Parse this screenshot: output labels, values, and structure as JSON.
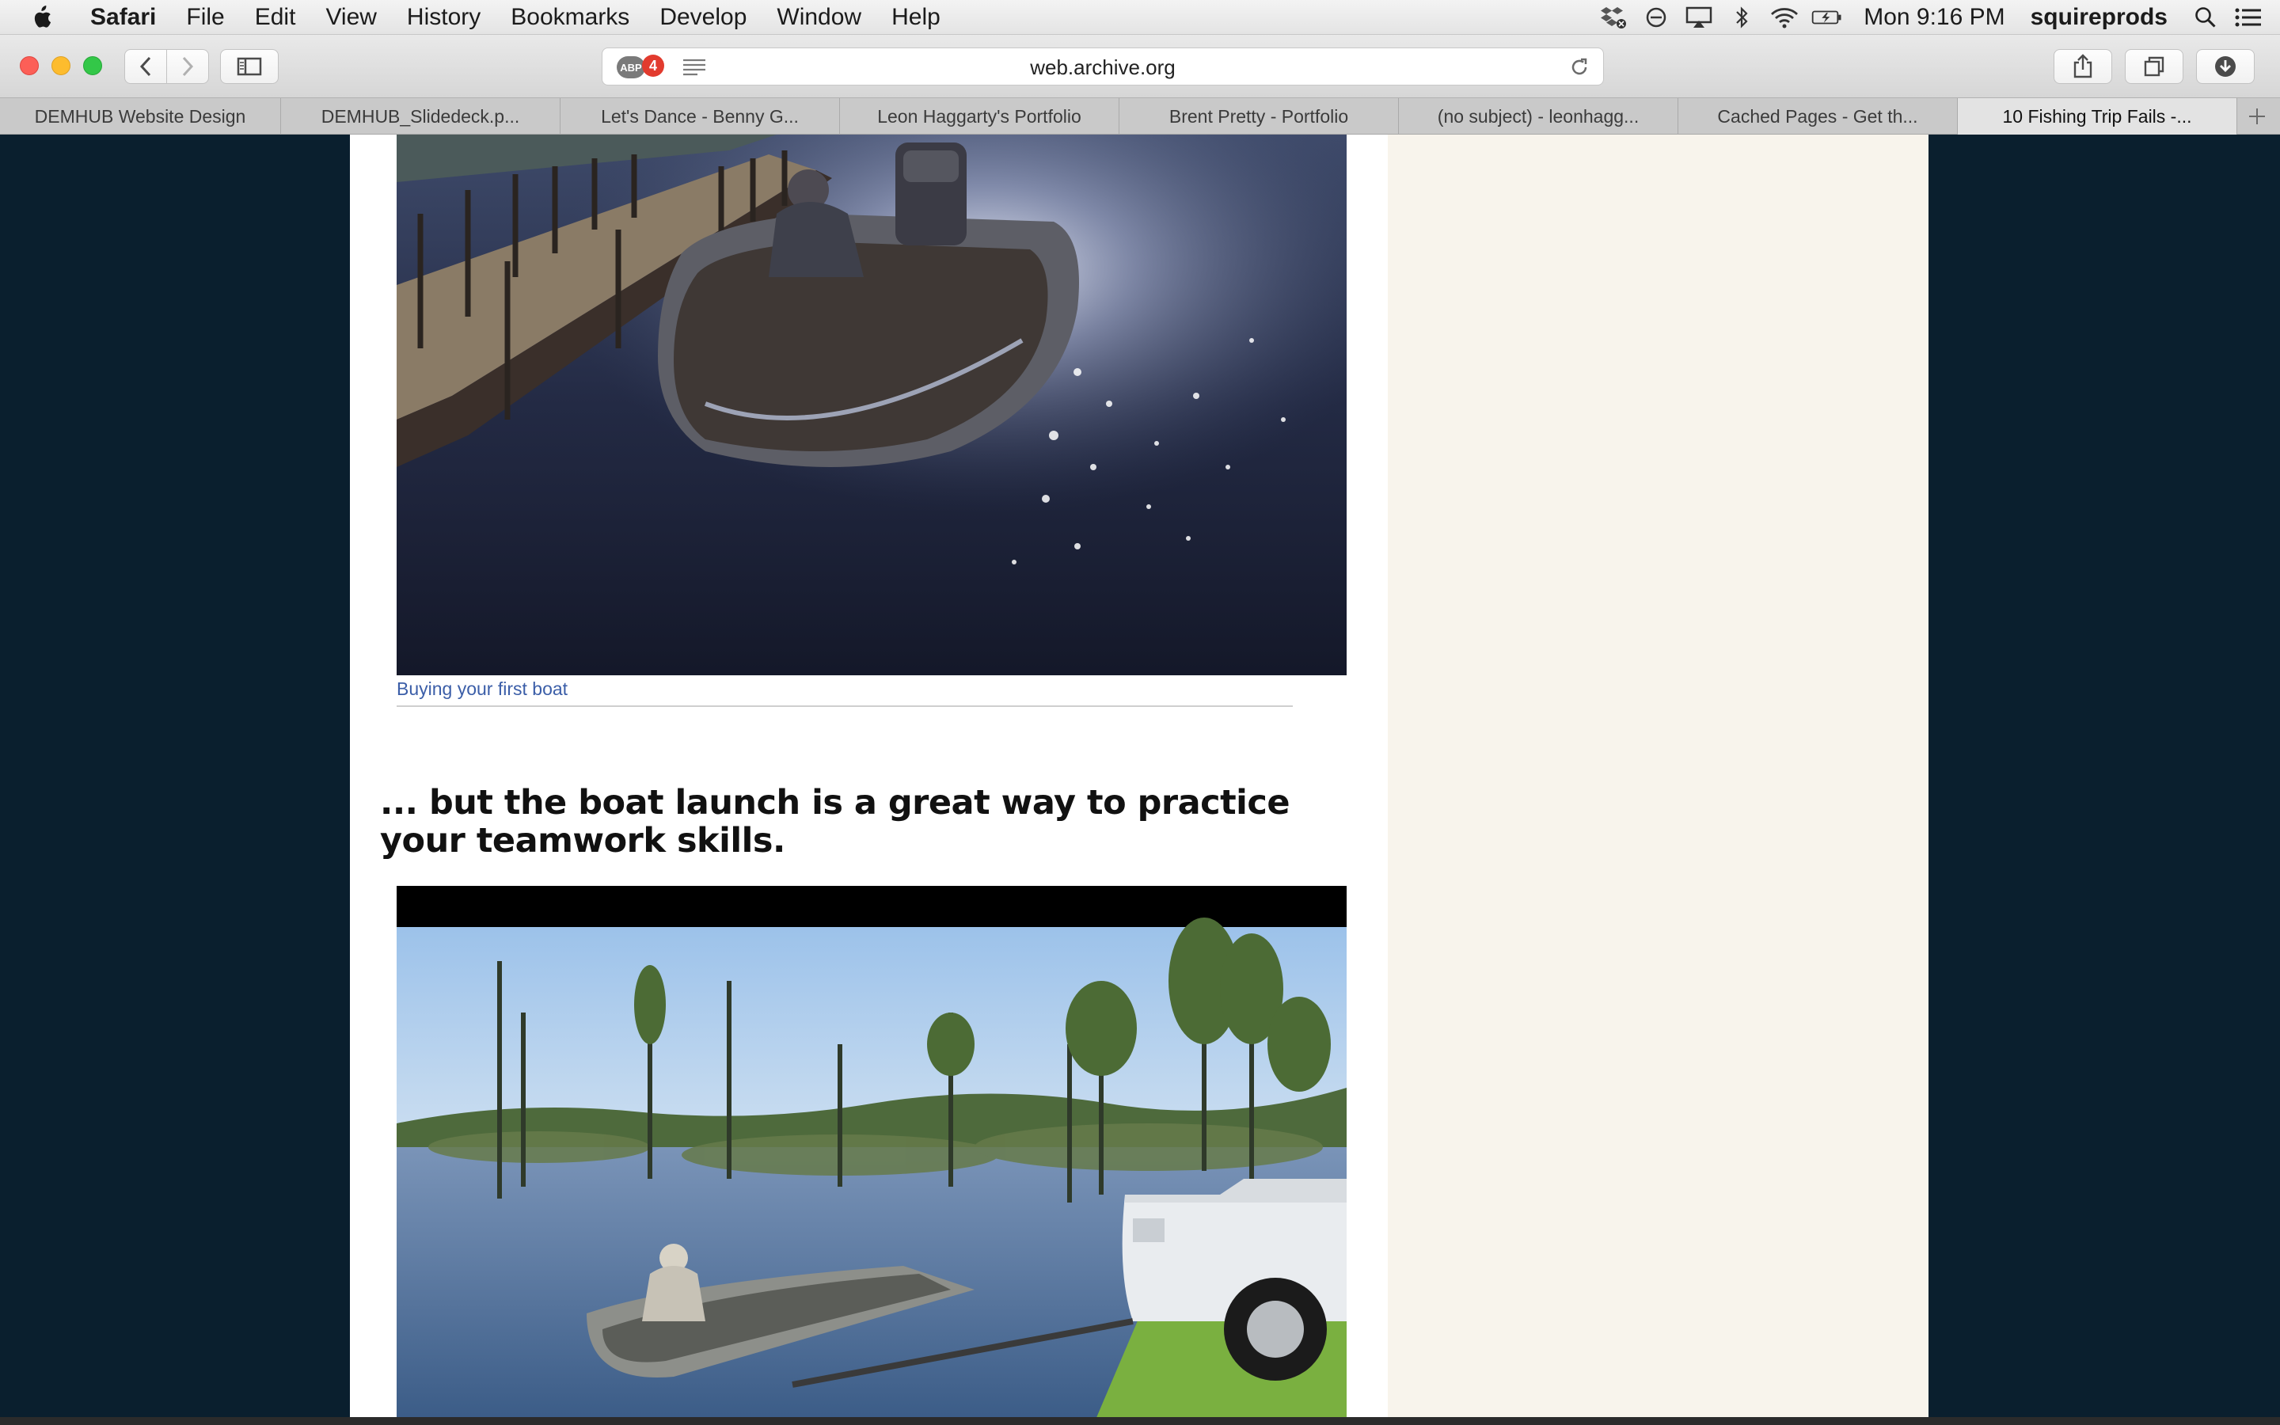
{
  "menubar": {
    "app_name": "Safari",
    "items": [
      "File",
      "Edit",
      "View",
      "History",
      "Bookmarks",
      "Develop",
      "Window",
      "Help"
    ],
    "clock": "Mon 9:16 PM",
    "user": "squireprods"
  },
  "toolbar": {
    "url": "web.archive.org",
    "adblock_label": "ABP",
    "adblock_count": "4"
  },
  "tabs": [
    {
      "label": "DEMHUB Website Design"
    },
    {
      "label": "DEMHUB_Slidedeck.p..."
    },
    {
      "label": "Let's Dance - Benny G..."
    },
    {
      "label": "Leon Haggarty's Portfolio"
    },
    {
      "label": "Brent Pretty - Portfolio"
    },
    {
      "label": "(no subject) - leonhagg..."
    },
    {
      "label": "Cached Pages - Get th..."
    },
    {
      "label": "10 Fishing Trip Fails -..."
    }
  ],
  "article": {
    "caption": "Buying your first boat",
    "heading": "...  but the boat launch is a great way to practice your teamwork skills."
  },
  "colors": {
    "page_background": "#0a1f2e",
    "sidebar_background": "#f8f4ec",
    "caption_link": "#3b5ea8"
  }
}
